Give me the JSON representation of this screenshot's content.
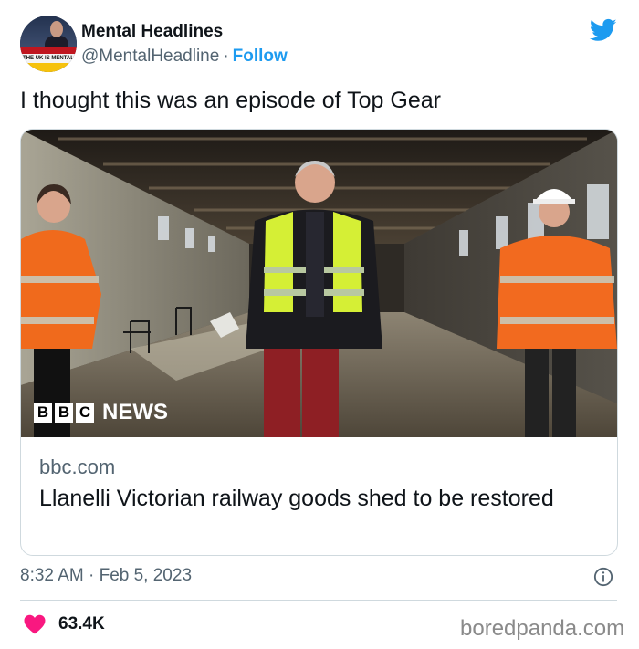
{
  "author": {
    "name": "Mental Headlines",
    "handle": "@MentalHeadline",
    "separator": "·",
    "follow_label": "Follow",
    "avatar_banner_text": "THE UK IS MENTAL"
  },
  "tweet": {
    "text": "I thought this was an episode of Top Gear",
    "timestamp": "8:32 AM · Feb 5, 2023",
    "likes": "63.4K"
  },
  "card": {
    "bbc_letters": [
      "B",
      "B",
      "C"
    ],
    "news_label": "NEWS",
    "domain": "bbc.com",
    "title": "Llanelli Victorian railway goods shed to be restored"
  },
  "watermark": "boredpanda.com",
  "colors": {
    "brand_blue": "#1d9bf0",
    "like_pink": "#f91880",
    "secondary_text": "#536471",
    "border": "#cfd9de"
  },
  "icons": {
    "brand": "twitter-bird-icon",
    "info": "info-icon",
    "like": "heart-icon"
  }
}
